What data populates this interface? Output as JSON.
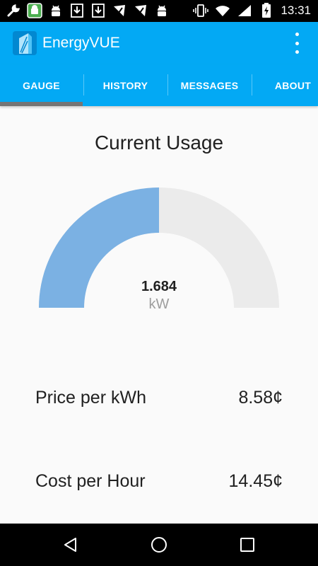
{
  "status_bar": {
    "time": "13:31",
    "left_icons": [
      "wrench-icon",
      "android-box-icon",
      "android-icon",
      "download-icon",
      "download-icon",
      "check-shield-icon",
      "check-shield-icon",
      "android-icon"
    ],
    "right_icons": [
      "vibrate-icon",
      "wifi-icon",
      "signal-icon",
      "battery-charging-icon"
    ]
  },
  "app_bar": {
    "title": "EnergyVUE",
    "color": "#03a9f4"
  },
  "tabs": [
    {
      "label": "GAUGE",
      "selected": true
    },
    {
      "label": "HISTORY",
      "selected": false
    },
    {
      "label": "MESSAGES",
      "selected": false
    },
    {
      "label": "ABOUT",
      "selected": false
    }
  ],
  "gauge": {
    "title": "Current Usage",
    "value": "1.684",
    "unit": "kW",
    "fill_fraction": 0.5,
    "fill_color": "#7bb1e3",
    "track_color": "#ebebeb"
  },
  "info": [
    {
      "label": "Price per kWh",
      "value": "8.58¢"
    },
    {
      "label": "Cost per Hour",
      "value": "14.45¢"
    }
  ]
}
